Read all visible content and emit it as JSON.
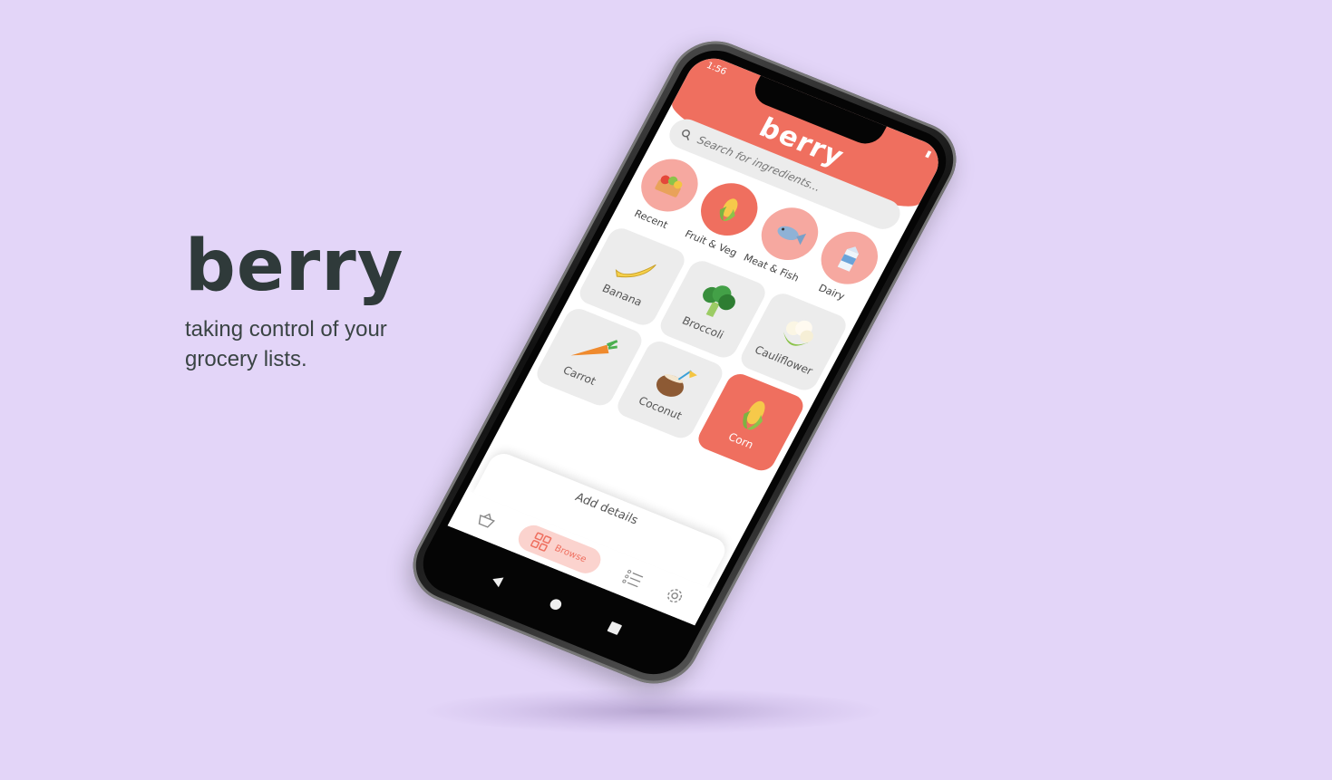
{
  "hero": {
    "title": "berry",
    "tagline": "taking control of your grocery lists."
  },
  "app": {
    "status_time": "1:56",
    "logo": "berry",
    "search_placeholder": "Search for ingredients...",
    "categories": [
      {
        "label": "Recent",
        "icon": "vegetable-box-icon",
        "active": false
      },
      {
        "label": "Fruit & Veg",
        "icon": "corn-icon",
        "active": true
      },
      {
        "label": "Meat & Fish",
        "icon": "fish-icon",
        "active": false
      },
      {
        "label": "Dairy",
        "icon": "milk-carton-icon",
        "active": false
      }
    ],
    "items": [
      {
        "label": "Banana",
        "icon": "banana-icon",
        "selected": false
      },
      {
        "label": "Broccoli",
        "icon": "broccoli-icon",
        "selected": false
      },
      {
        "label": "Cauliflower",
        "icon": "cauliflower-icon",
        "selected": false
      },
      {
        "label": "Carrot",
        "icon": "carrot-icon",
        "selected": false
      },
      {
        "label": "Coconut",
        "icon": "coconut-icon",
        "selected": false
      },
      {
        "label": "Corn",
        "icon": "corn-icon",
        "selected": true
      }
    ],
    "sheet_label": "Add details",
    "nav": {
      "basket_icon": "basket-icon",
      "browse_label": "Browse",
      "list_icon": "list-icon",
      "settings_icon": "gear-icon"
    }
  },
  "colors": {
    "background": "#e3d5f8",
    "accent": "#ef6f5f",
    "accent_light": "#f6a8a0",
    "text_dark": "#2f3a3a"
  }
}
